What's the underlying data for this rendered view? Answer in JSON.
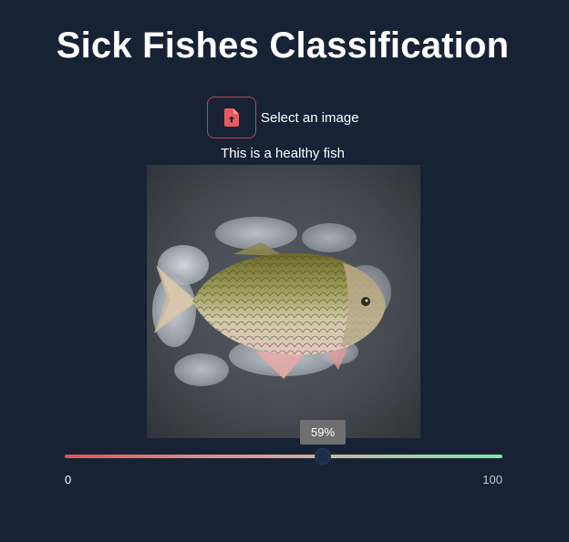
{
  "page": {
    "title": "Sick Fishes Classification"
  },
  "uploader": {
    "icon": "file-upload-icon",
    "label": "Select an image",
    "accent_color": "#e85a5f"
  },
  "result": {
    "text": "This is a healthy fish"
  },
  "image": {
    "subject": "fish"
  },
  "confidence_slider": {
    "value": 59,
    "value_label": "59%",
    "min": 0,
    "max": 100,
    "min_label": "0",
    "max_label": "100",
    "gradient_start": "#e0545a",
    "gradient_end": "#7fe3a2"
  }
}
